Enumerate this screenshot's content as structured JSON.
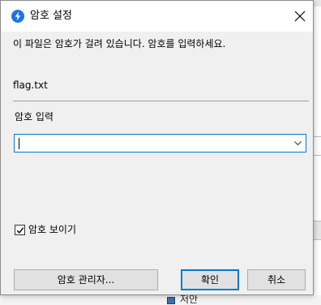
{
  "dialog": {
    "title": "암호 설정",
    "message": "이 파일은 암호가 걸려 있습니다. 암호를 입력하세요.",
    "filename": "flag.txt",
    "password_label": "암호 입력",
    "password_value": "",
    "show_password_label": "암호 보이기",
    "show_password_checked": true,
    "buttons": {
      "manager": "암호 관리자...",
      "ok": "확인",
      "cancel": "취소"
    }
  },
  "background": {
    "bottom_text": "저안"
  },
  "icons": {
    "title": "app-lightning-icon",
    "close": "close-icon",
    "dropdown": "chevron-down-icon",
    "checkbox": "checkmark-icon"
  },
  "colors": {
    "accent": "#0078d7",
    "title_icon": "#1a73e8",
    "button_face": "#e1e1e1"
  }
}
